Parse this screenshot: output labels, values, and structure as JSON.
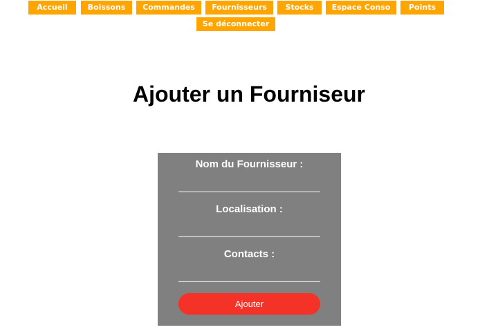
{
  "nav": {
    "items": [
      {
        "label": "Accueil"
      },
      {
        "label": "Boissons"
      },
      {
        "label": "Commandes"
      },
      {
        "label": "Fournisseurs"
      },
      {
        "label": "Stocks"
      },
      {
        "label": "Espace Conso"
      },
      {
        "label": "Points"
      },
      {
        "label": "Se déconnecter"
      }
    ]
  },
  "page": {
    "title": "Ajouter un Fourniseur"
  },
  "form": {
    "fields": [
      {
        "label": "Nom du Fournisseur :",
        "value": ""
      },
      {
        "label": "Localisation :",
        "value": ""
      },
      {
        "label": "Contacts :",
        "value": ""
      }
    ],
    "submit_label": "Ajouter"
  },
  "colors": {
    "nav_background": "#ffa500",
    "form_background": "#808080",
    "submit_background": "#f53227"
  }
}
